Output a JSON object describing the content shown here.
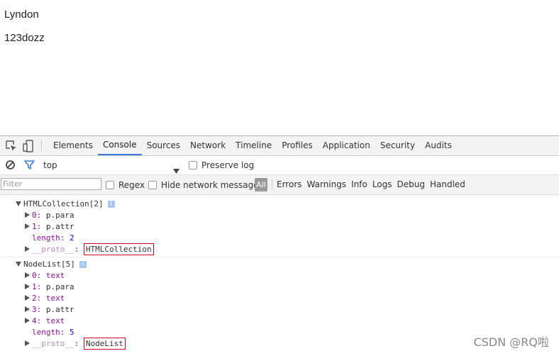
{
  "page": {
    "lines": [
      "Lyndon",
      "123dozz"
    ]
  },
  "devtools": {
    "tabs": [
      "Elements",
      "Console",
      "Sources",
      "Network",
      "Timeline",
      "Profiles",
      "Application",
      "Security",
      "Audits"
    ],
    "active_tab": "Console",
    "icons": [
      "inspect-element-icon",
      "device-mode-icon",
      "clear-console-icon",
      "filter-icon",
      "dropdown-arrow-icon"
    ],
    "context": {
      "value": "top",
      "preserve_log_label": "Preserve log"
    },
    "filterbar": {
      "placeholder": "Filter",
      "regex_label": "Regex",
      "hide_network_label": "Hide network messages",
      "all_label": "All",
      "levels": [
        "Errors",
        "Warnings",
        "Info",
        "Logs",
        "Debug",
        "Handled"
      ]
    },
    "log": {
      "groups": [
        {
          "title": "HTMLCollection[2]",
          "badge": "i",
          "items": [
            {
              "key": "0",
              "value": "p.para"
            },
            {
              "key": "1",
              "value": "p.attr"
            }
          ],
          "length_key": "length",
          "length_value": "2",
          "proto_key": "__proto__",
          "proto_value": "HTMLCollection"
        },
        {
          "title": "NodeList[5]",
          "badge": "i",
          "items": [
            {
              "key": "0",
              "value": "text"
            },
            {
              "key": "1",
              "value": "p.para"
            },
            {
              "key": "2",
              "value": "text"
            },
            {
              "key": "3",
              "value": "p.attr"
            },
            {
              "key": "4",
              "value": "text"
            }
          ],
          "length_key": "length",
          "length_value": "5",
          "proto_key": "__proto__",
          "proto_value": "NodeList"
        }
      ]
    }
  },
  "watermark": "CSDN @RQ啦"
}
